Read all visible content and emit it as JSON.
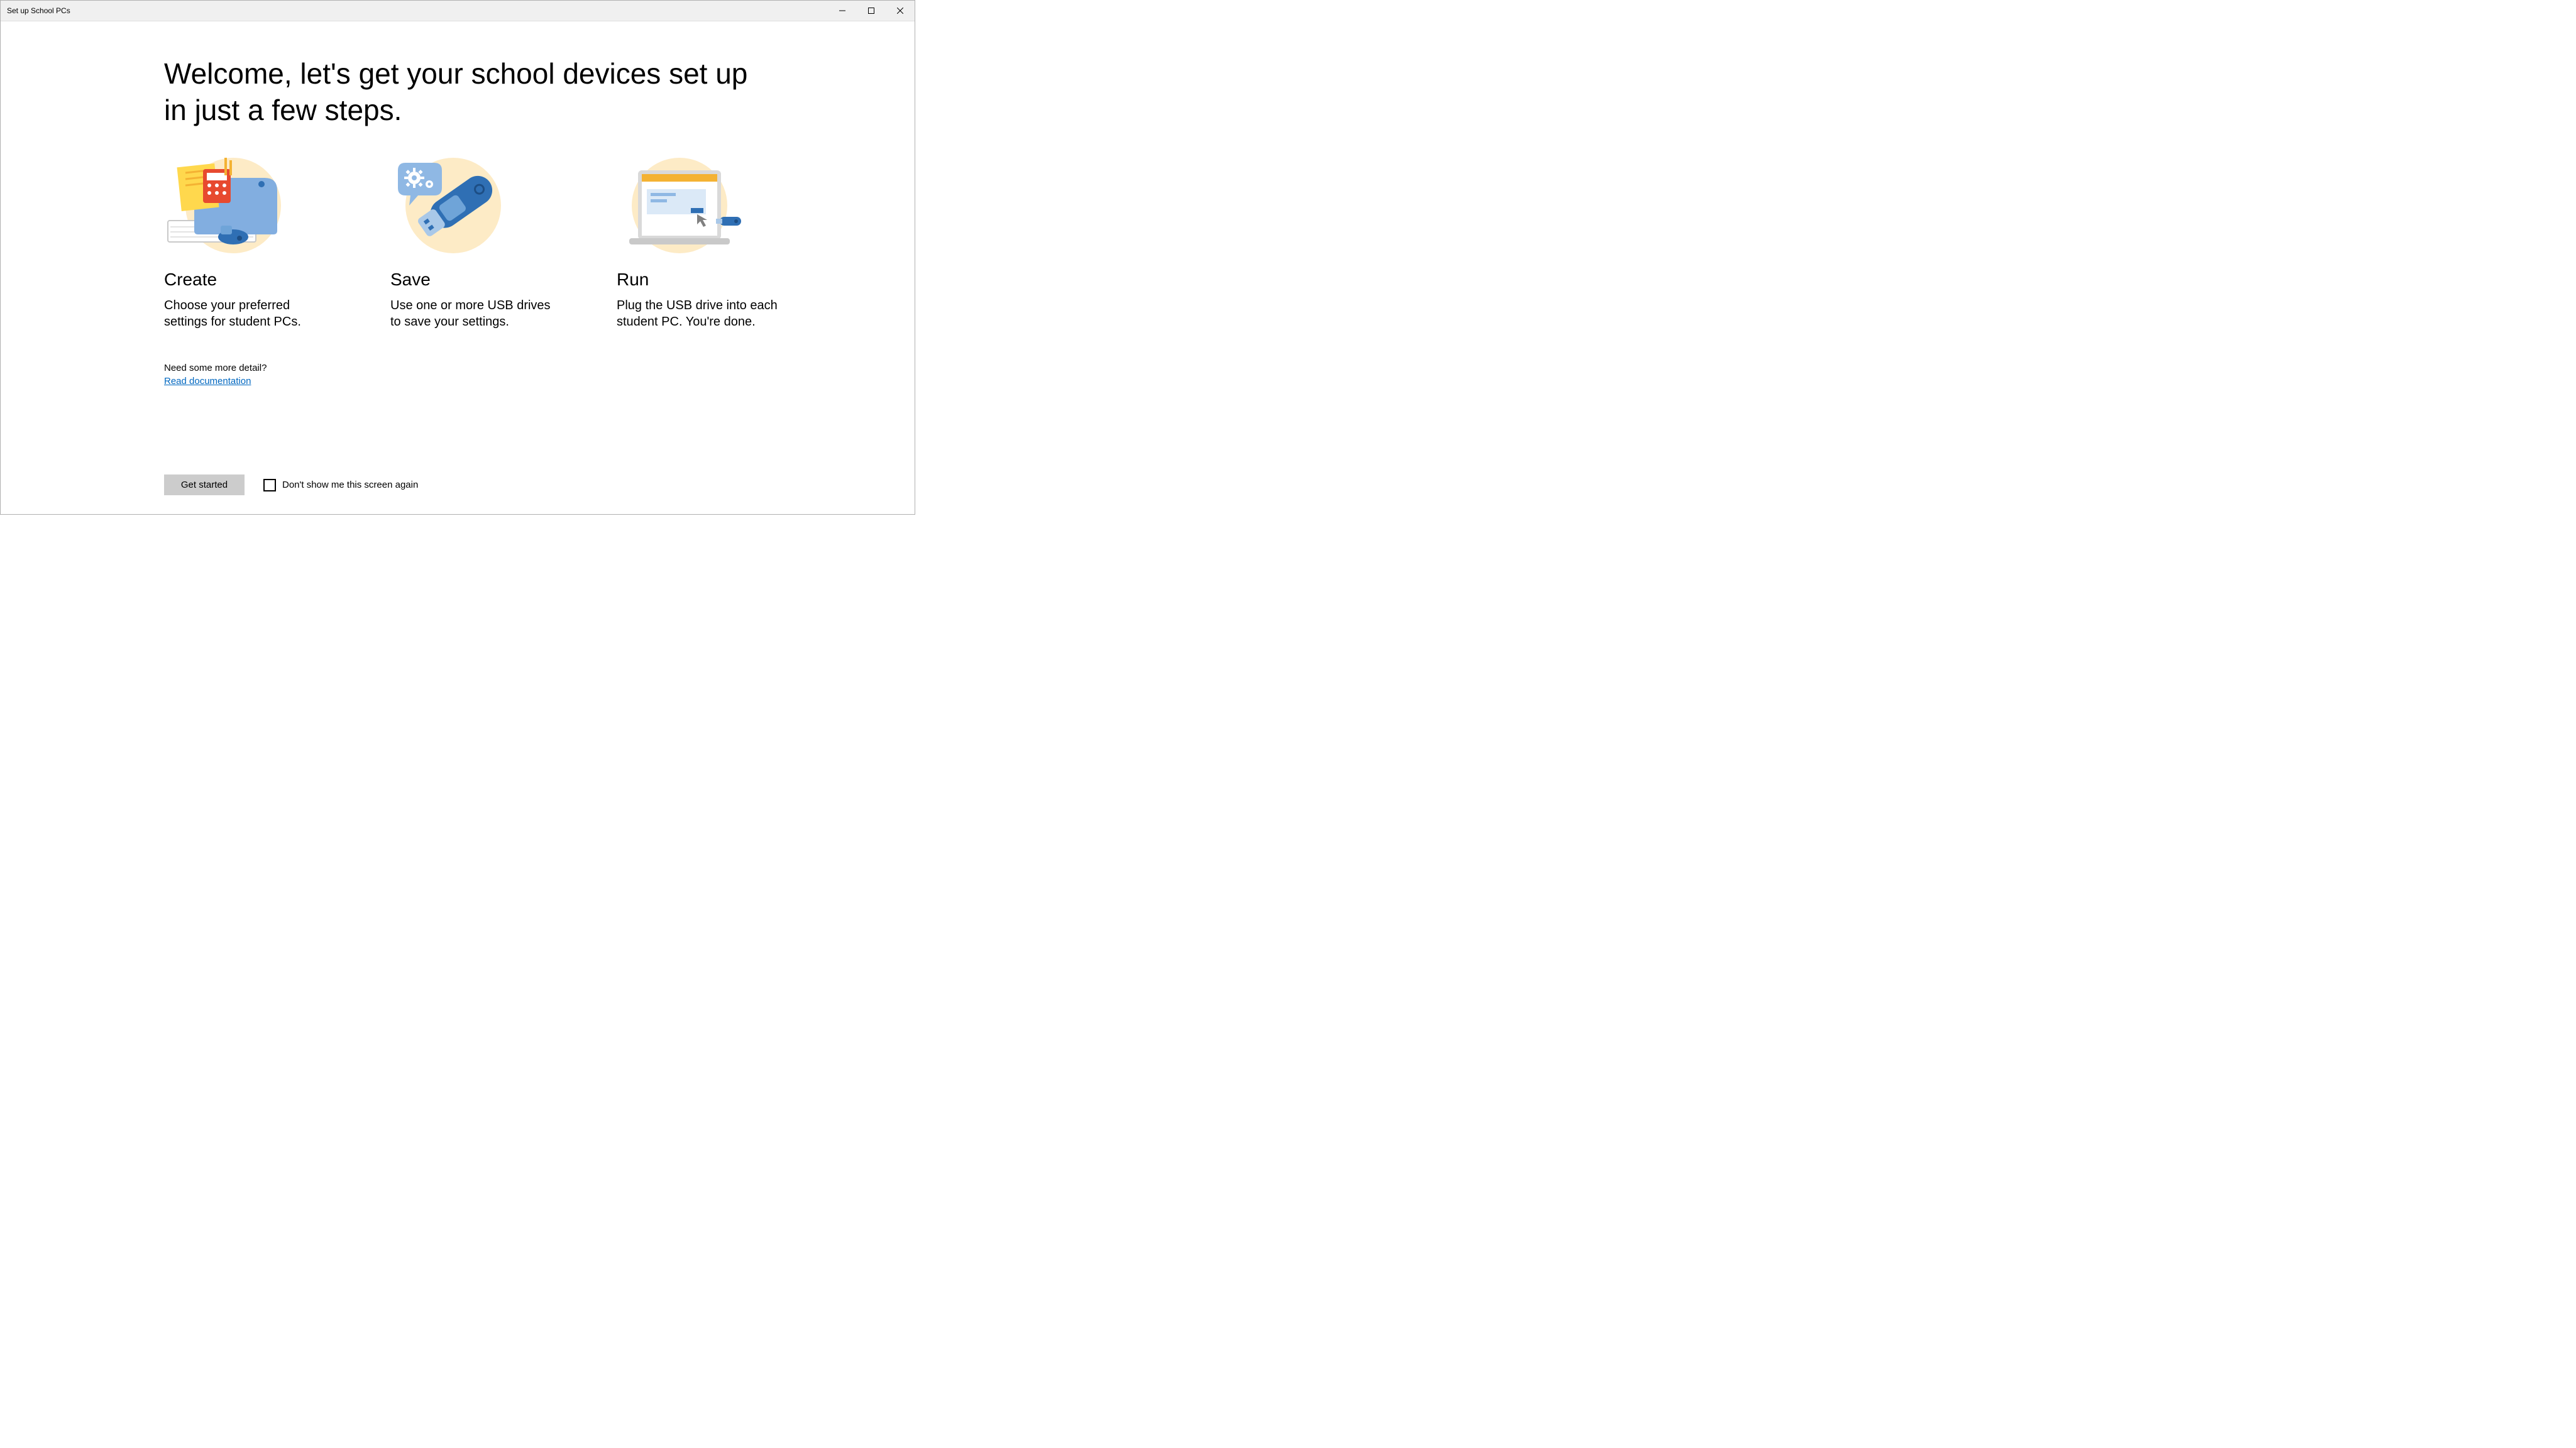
{
  "window": {
    "title": "Set up School PCs"
  },
  "headline": "Welcome, let's get your school devices set up in just a few steps.",
  "steps": [
    {
      "title": "Create",
      "desc": "Choose your preferred settings for student PCs."
    },
    {
      "title": "Save",
      "desc": "Use one or more USB drives to save your settings."
    },
    {
      "title": "Run",
      "desc": "Plug the USB drive into each student PC. You're done."
    }
  ],
  "help": {
    "prompt": "Need some more detail?",
    "link_label": "Read documentation"
  },
  "footer": {
    "get_started": "Get started",
    "dont_show": "Don't show me this screen again"
  },
  "colors": {
    "accent_blue": "#2f6fb4",
    "accent_yellow": "#fdebc6",
    "accent_orange": "#f4b233",
    "link": "#0067c0"
  }
}
